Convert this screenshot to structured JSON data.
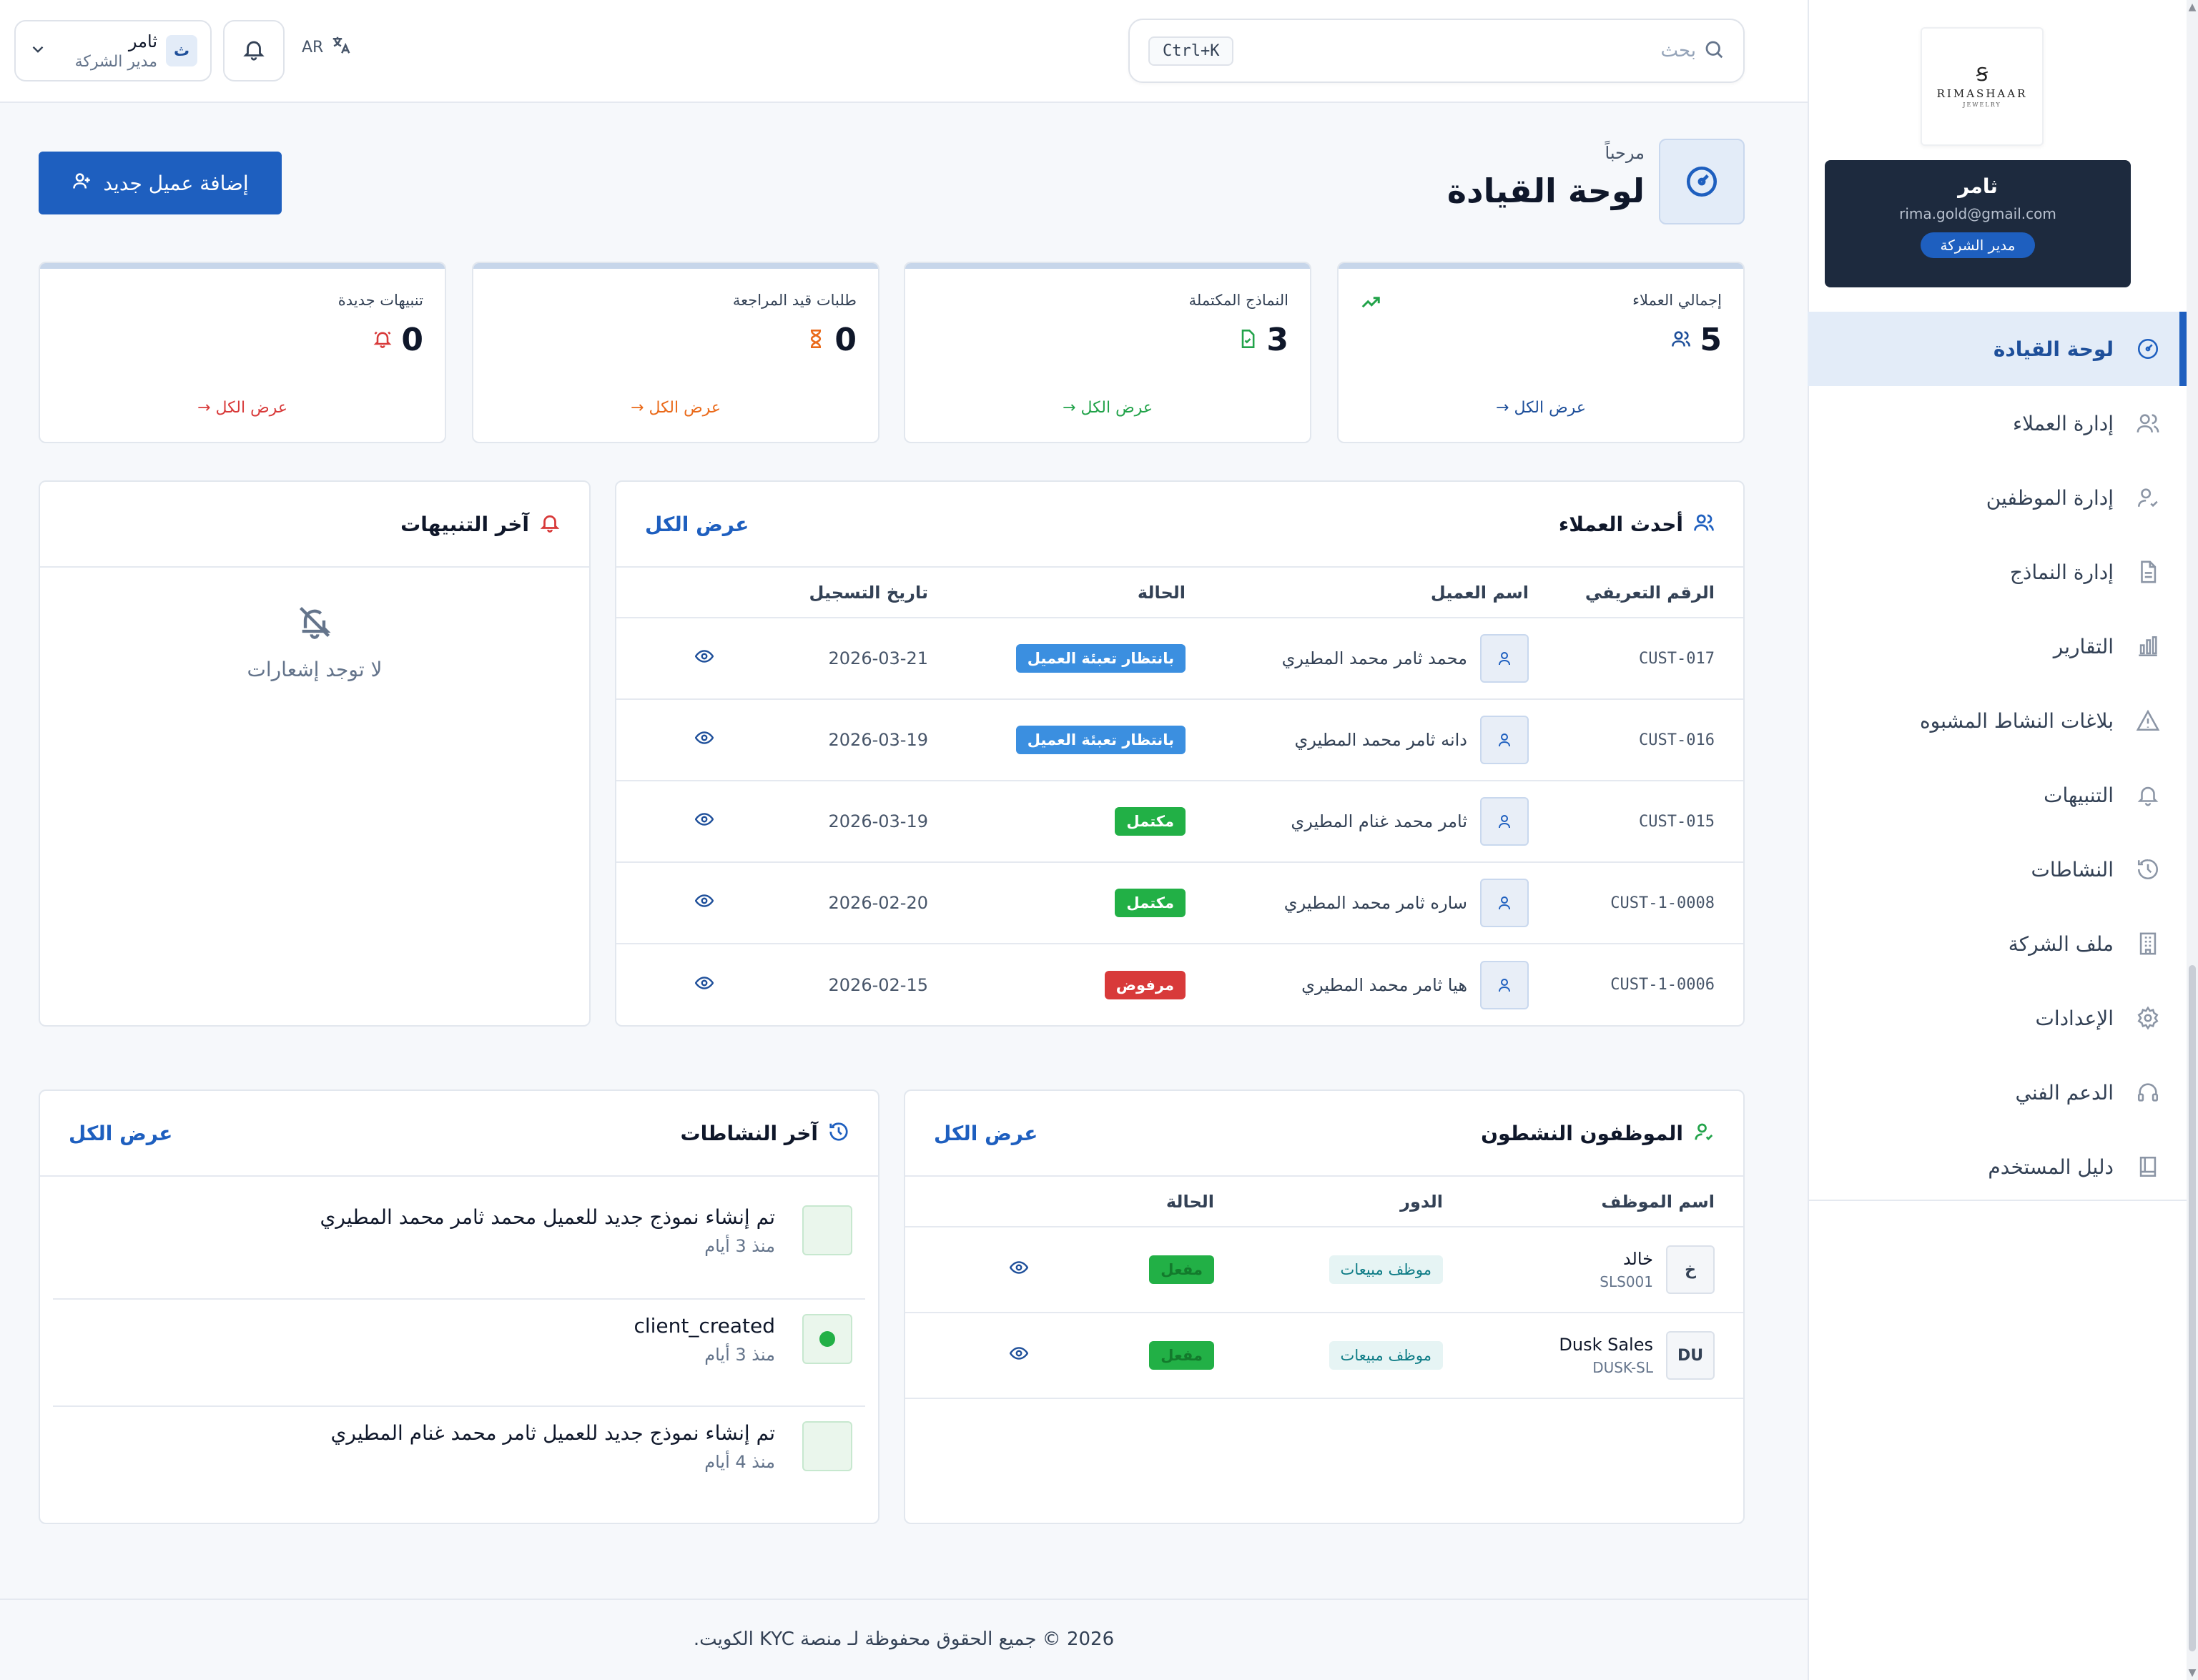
{
  "colors": {
    "primary": "#1e5fbf",
    "sidebar_card": "#1d2a3e",
    "success": "#22b046",
    "danger": "#d83a3a",
    "warning": "#ea6a1a",
    "info": "#3b8fe0"
  },
  "sidebar": {
    "logo": {
      "mark": "Ꞩ",
      "text": "RIMASHAAR",
      "sub": "JEWELRY"
    },
    "user": {
      "name": "ثامر",
      "email": "rima.gold@gmail.com",
      "role": "مدير الشركة"
    },
    "items": [
      {
        "label": "لوحة القيادة",
        "icon": "dashboard-icon",
        "active": true
      },
      {
        "label": "إدارة العملاء",
        "icon": "users-icon"
      },
      {
        "label": "إدارة الموظفين",
        "icon": "user-check-icon"
      },
      {
        "label": "إدارة النماذج",
        "icon": "document-icon"
      },
      {
        "label": "التقارير",
        "icon": "bar-chart-icon"
      },
      {
        "label": "بلاغات النشاط المشبوه",
        "icon": "warning-icon"
      },
      {
        "label": "التنبيهات",
        "icon": "bell-icon"
      },
      {
        "label": "النشاطات",
        "icon": "history-icon"
      },
      {
        "label": "ملف الشركة",
        "icon": "building-icon"
      },
      {
        "label": "الإعدادات",
        "icon": "gear-icon"
      },
      {
        "label": "الدعم الفني",
        "icon": "headset-icon"
      },
      {
        "label": "دليل المستخدم",
        "icon": "book-icon"
      }
    ]
  },
  "topbar": {
    "search_placeholder": "بحث",
    "shortcut": "Ctrl+K",
    "language": "AR",
    "user": {
      "initial": "ث",
      "name": "ثامر",
      "role": "مدير الشركة"
    }
  },
  "header": {
    "welcome": "مرحباً",
    "title": "لوحة القيادة",
    "add_client": "إضافة عميل جديد"
  },
  "stats": [
    {
      "label": "إجمالي العملاء",
      "value": "5",
      "link": "عرض الكل →",
      "color": "#1e4f9a",
      "icon": "users-icon"
    },
    {
      "label": "النماذج المكتملة",
      "value": "3",
      "link": "عرض الكل →",
      "color": "#22a34a",
      "icon": "file-check-icon"
    },
    {
      "label": "طلبات قيد المراجعة",
      "value": "0",
      "link": "عرض الكل →",
      "color": "#ea6a1a",
      "icon": "hourglass-icon"
    },
    {
      "label": "تنبيهات جديدة",
      "value": "0",
      "link": "عرض الكل →",
      "color": "#d83a3a",
      "icon": "bell-ring-icon"
    }
  ],
  "clients": {
    "title": "أحدث العملاء",
    "view_all": "عرض الكل",
    "columns": [
      "الرقم التعريفي",
      "اسم العميل",
      "الحالة",
      "تاريخ التسجيل"
    ],
    "rows": [
      {
        "id": "CUST-017",
        "name": "محمد ثامر محمد المطيري",
        "status": "بانتظار تعبئة العميل",
        "status_color": "blue",
        "date": "2026-03-21"
      },
      {
        "id": "CUST-016",
        "name": "دانه ثامر محمد المطيري",
        "status": "بانتظار تعبئة العميل",
        "status_color": "blue",
        "date": "2026-03-19"
      },
      {
        "id": "CUST-015",
        "name": "ثامر محمد غنام المطيري",
        "status": "مكتمل",
        "status_color": "green",
        "date": "2026-03-19"
      },
      {
        "id": "CUST-1-0008",
        "name": "ساره ثامر محمد المطيري",
        "status": "مكتمل",
        "status_color": "green",
        "date": "2026-02-20"
      },
      {
        "id": "CUST-1-0006",
        "name": "هيا ثامر محمد المطيري",
        "status": "مرفوض",
        "status_color": "red",
        "date": "2026-02-15"
      }
    ]
  },
  "notifications": {
    "title": "آخر التنبيهات",
    "empty": "لا توجد إشعارات"
  },
  "employees": {
    "title": "الموظفون النشطون",
    "view_all": "عرض الكل",
    "columns": [
      "اسم الموظف",
      "الدور",
      "الحالة"
    ],
    "rows": [
      {
        "initial": "خ",
        "name": "خالد",
        "code": "SLS001",
        "role": "موظف مبيعات",
        "status": "مفعل"
      },
      {
        "initial": "DU",
        "name": "Dusk Sales",
        "code": "DUSK-SL",
        "role": "موظف مبيعات",
        "status": "مفعل"
      }
    ]
  },
  "activities": {
    "title": "آخر النشاطات",
    "view_all": "عرض الكل",
    "items": [
      {
        "title": "تم إنشاء نموذج جديد للعميل محمد ثامر محمد المطيري",
        "time": "منذ 3 أيام",
        "dot": false
      },
      {
        "title": "client_created",
        "time": "منذ 3 أيام",
        "dot": true
      },
      {
        "title": "تم إنشاء نموذج جديد للعميل ثامر محمد غنام المطيري",
        "time": "منذ 4 أيام",
        "dot": false
      }
    ]
  },
  "footer": "2026 © جميع الحقوق محفوظة لـ منصة KYC الكويت."
}
